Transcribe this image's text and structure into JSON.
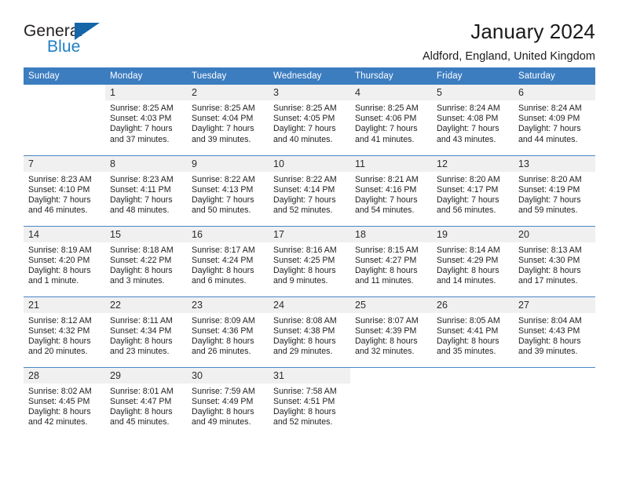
{
  "brand": {
    "name_part1": "General",
    "name_part2": "Blue",
    "flag_icon": "blue-flag-triangle"
  },
  "header": {
    "title": "January 2024",
    "location": "Aldford, England, United Kingdom"
  },
  "colors": {
    "header_bar": "#3c7dc0",
    "daynum_band": "#f0f0f0",
    "brand_blue": "#1f7fc4",
    "flag_blue": "#1565a8",
    "row_divider": "#4a86c5"
  },
  "weekday_headers": [
    "Sunday",
    "Monday",
    "Tuesday",
    "Wednesday",
    "Thursday",
    "Friday",
    "Saturday"
  ],
  "labels": {
    "sunrise_prefix": "Sunrise:",
    "sunset_prefix": "Sunset:",
    "daylight_prefix": "Daylight:"
  },
  "weeks": [
    [
      {
        "day": "",
        "lines": []
      },
      {
        "day": "1",
        "lines": [
          "Sunrise: 8:25 AM",
          "Sunset: 4:03 PM",
          "Daylight: 7 hours",
          "and 37 minutes."
        ]
      },
      {
        "day": "2",
        "lines": [
          "Sunrise: 8:25 AM",
          "Sunset: 4:04 PM",
          "Daylight: 7 hours",
          "and 39 minutes."
        ]
      },
      {
        "day": "3",
        "lines": [
          "Sunrise: 8:25 AM",
          "Sunset: 4:05 PM",
          "Daylight: 7 hours",
          "and 40 minutes."
        ]
      },
      {
        "day": "4",
        "lines": [
          "Sunrise: 8:25 AM",
          "Sunset: 4:06 PM",
          "Daylight: 7 hours",
          "and 41 minutes."
        ]
      },
      {
        "day": "5",
        "lines": [
          "Sunrise: 8:24 AM",
          "Sunset: 4:08 PM",
          "Daylight: 7 hours",
          "and 43 minutes."
        ]
      },
      {
        "day": "6",
        "lines": [
          "Sunrise: 8:24 AM",
          "Sunset: 4:09 PM",
          "Daylight: 7 hours",
          "and 44 minutes."
        ]
      }
    ],
    [
      {
        "day": "7",
        "lines": [
          "Sunrise: 8:23 AM",
          "Sunset: 4:10 PM",
          "Daylight: 7 hours",
          "and 46 minutes."
        ]
      },
      {
        "day": "8",
        "lines": [
          "Sunrise: 8:23 AM",
          "Sunset: 4:11 PM",
          "Daylight: 7 hours",
          "and 48 minutes."
        ]
      },
      {
        "day": "9",
        "lines": [
          "Sunrise: 8:22 AM",
          "Sunset: 4:13 PM",
          "Daylight: 7 hours",
          "and 50 minutes."
        ]
      },
      {
        "day": "10",
        "lines": [
          "Sunrise: 8:22 AM",
          "Sunset: 4:14 PM",
          "Daylight: 7 hours",
          "and 52 minutes."
        ]
      },
      {
        "day": "11",
        "lines": [
          "Sunrise: 8:21 AM",
          "Sunset: 4:16 PM",
          "Daylight: 7 hours",
          "and 54 minutes."
        ]
      },
      {
        "day": "12",
        "lines": [
          "Sunrise: 8:20 AM",
          "Sunset: 4:17 PM",
          "Daylight: 7 hours",
          "and 56 minutes."
        ]
      },
      {
        "day": "13",
        "lines": [
          "Sunrise: 8:20 AM",
          "Sunset: 4:19 PM",
          "Daylight: 7 hours",
          "and 59 minutes."
        ]
      }
    ],
    [
      {
        "day": "14",
        "lines": [
          "Sunrise: 8:19 AM",
          "Sunset: 4:20 PM",
          "Daylight: 8 hours",
          "and 1 minute."
        ]
      },
      {
        "day": "15",
        "lines": [
          "Sunrise: 8:18 AM",
          "Sunset: 4:22 PM",
          "Daylight: 8 hours",
          "and 3 minutes."
        ]
      },
      {
        "day": "16",
        "lines": [
          "Sunrise: 8:17 AM",
          "Sunset: 4:24 PM",
          "Daylight: 8 hours",
          "and 6 minutes."
        ]
      },
      {
        "day": "17",
        "lines": [
          "Sunrise: 8:16 AM",
          "Sunset: 4:25 PM",
          "Daylight: 8 hours",
          "and 9 minutes."
        ]
      },
      {
        "day": "18",
        "lines": [
          "Sunrise: 8:15 AM",
          "Sunset: 4:27 PM",
          "Daylight: 8 hours",
          "and 11 minutes."
        ]
      },
      {
        "day": "19",
        "lines": [
          "Sunrise: 8:14 AM",
          "Sunset: 4:29 PM",
          "Daylight: 8 hours",
          "and 14 minutes."
        ]
      },
      {
        "day": "20",
        "lines": [
          "Sunrise: 8:13 AM",
          "Sunset: 4:30 PM",
          "Daylight: 8 hours",
          "and 17 minutes."
        ]
      }
    ],
    [
      {
        "day": "21",
        "lines": [
          "Sunrise: 8:12 AM",
          "Sunset: 4:32 PM",
          "Daylight: 8 hours",
          "and 20 minutes."
        ]
      },
      {
        "day": "22",
        "lines": [
          "Sunrise: 8:11 AM",
          "Sunset: 4:34 PM",
          "Daylight: 8 hours",
          "and 23 minutes."
        ]
      },
      {
        "day": "23",
        "lines": [
          "Sunrise: 8:09 AM",
          "Sunset: 4:36 PM",
          "Daylight: 8 hours",
          "and 26 minutes."
        ]
      },
      {
        "day": "24",
        "lines": [
          "Sunrise: 8:08 AM",
          "Sunset: 4:38 PM",
          "Daylight: 8 hours",
          "and 29 minutes."
        ]
      },
      {
        "day": "25",
        "lines": [
          "Sunrise: 8:07 AM",
          "Sunset: 4:39 PM",
          "Daylight: 8 hours",
          "and 32 minutes."
        ]
      },
      {
        "day": "26",
        "lines": [
          "Sunrise: 8:05 AM",
          "Sunset: 4:41 PM",
          "Daylight: 8 hours",
          "and 35 minutes."
        ]
      },
      {
        "day": "27",
        "lines": [
          "Sunrise: 8:04 AM",
          "Sunset: 4:43 PM",
          "Daylight: 8 hours",
          "and 39 minutes."
        ]
      }
    ],
    [
      {
        "day": "28",
        "lines": [
          "Sunrise: 8:02 AM",
          "Sunset: 4:45 PM",
          "Daylight: 8 hours",
          "and 42 minutes."
        ]
      },
      {
        "day": "29",
        "lines": [
          "Sunrise: 8:01 AM",
          "Sunset: 4:47 PM",
          "Daylight: 8 hours",
          "and 45 minutes."
        ]
      },
      {
        "day": "30",
        "lines": [
          "Sunrise: 7:59 AM",
          "Sunset: 4:49 PM",
          "Daylight: 8 hours",
          "and 49 minutes."
        ]
      },
      {
        "day": "31",
        "lines": [
          "Sunrise: 7:58 AM",
          "Sunset: 4:51 PM",
          "Daylight: 8 hours",
          "and 52 minutes."
        ]
      },
      {
        "day": "",
        "lines": []
      },
      {
        "day": "",
        "lines": []
      },
      {
        "day": "",
        "lines": []
      }
    ]
  ]
}
